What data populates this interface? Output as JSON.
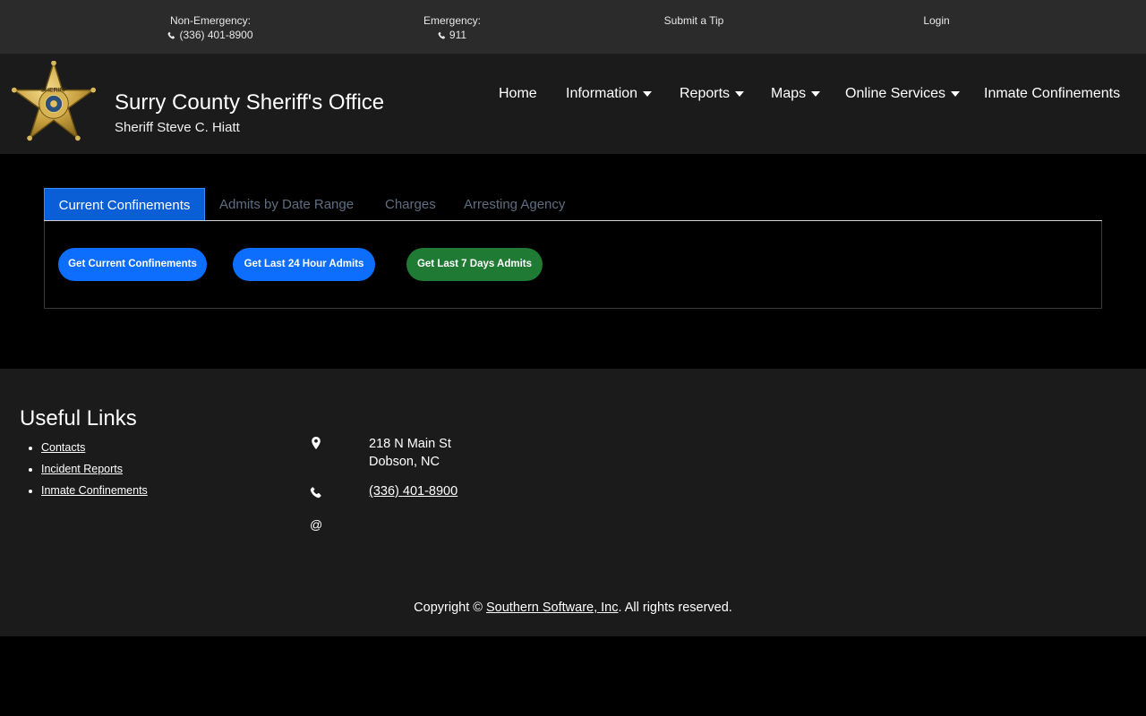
{
  "topbar": {
    "non_emergency_label": "Non-Emergency:",
    "non_emergency_phone": "(336) 401-8900",
    "emergency_label": "Emergency:",
    "emergency_phone": "911",
    "submit_tip": "Submit a Tip",
    "login": "Login"
  },
  "header": {
    "title": "Surry County Sheriff's Office",
    "subtitle": "Sheriff Steve C. Hiatt",
    "badge_text": "SHERIFF",
    "nav": [
      {
        "label": "Home",
        "dropdown": false
      },
      {
        "label": "Information",
        "dropdown": true
      },
      {
        "label": "Reports",
        "dropdown": true
      },
      {
        "label": "Maps",
        "dropdown": true
      },
      {
        "label": "Online Services",
        "dropdown": true
      },
      {
        "label": "Inmate Confinements",
        "dropdown": false
      }
    ]
  },
  "tabs": {
    "items": [
      "Current Confinements",
      "Admits by Date Range",
      "Charges",
      "Arresting Agency"
    ],
    "active": "Current Confinements"
  },
  "actions": {
    "current": "Get Current Confinements",
    "last24": "Get Last 24 Hour Admits",
    "last7": "Get Last 7 Days Admits"
  },
  "footer": {
    "useful_title": "Useful Links",
    "links": [
      "Contacts",
      "Incident Reports",
      "Inmate Confinements"
    ],
    "address_line1": "218 N Main St",
    "address_line2": "Dobson, NC",
    "phone": "(336) 401-8900",
    "email_icon": "@",
    "copyright_prefix": "Copyright © ",
    "company": "Southern Software, Inc",
    "copyright_suffix": ". All rights reserved."
  },
  "colors": {
    "topbar_bg": "#2b2b2b",
    "header_bg": "#1b1b1b",
    "primary_blue": "#0d6efd",
    "success_green": "#1f7a34",
    "inactive_tab": "#5f6d80"
  }
}
